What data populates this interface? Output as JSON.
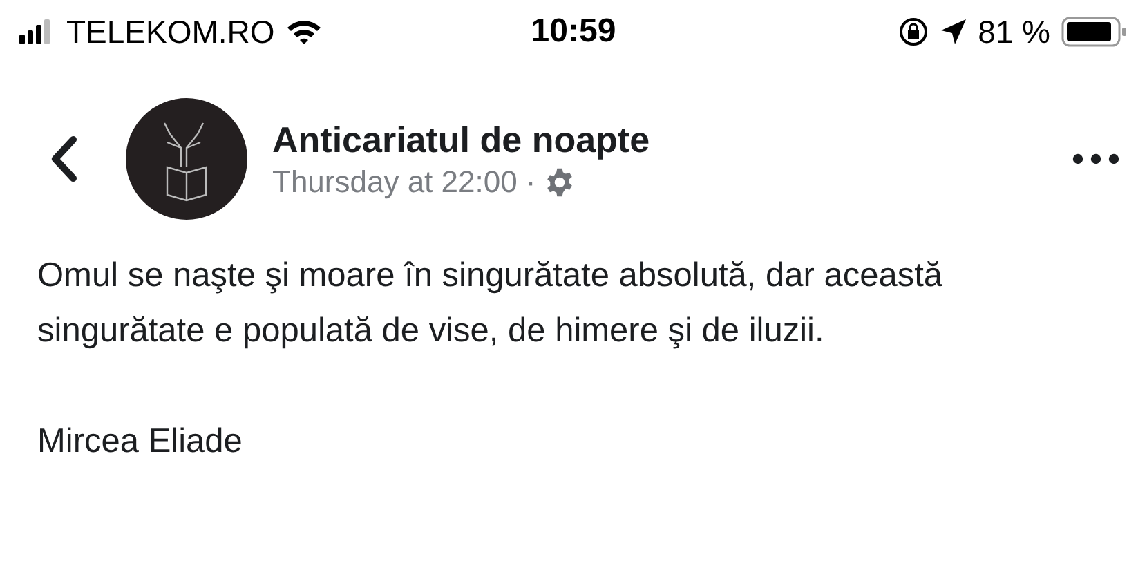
{
  "status_bar": {
    "carrier": "TELEKOM.RO",
    "time": "10:59",
    "battery": "81 %"
  },
  "post": {
    "page_name": "Anticariatul de noapte",
    "timestamp": "Thursday at 22:00",
    "separator": "·",
    "body": "Omul se naşte şi moare în singurătate absolută, dar această singurătate e populată de vise, de himere şi de iluzii.",
    "author": "Mircea Eliade"
  }
}
